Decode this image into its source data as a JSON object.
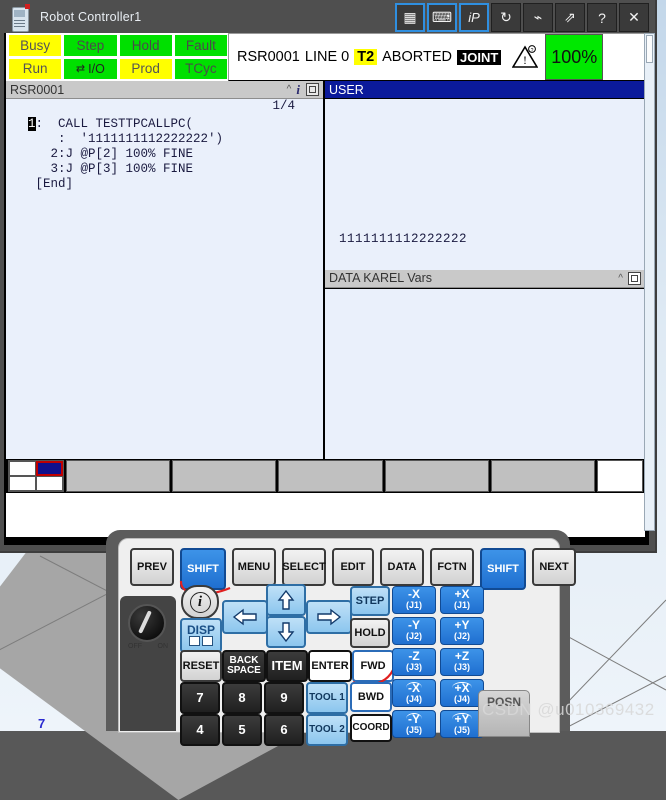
{
  "window": {
    "title": "Robot Controller1",
    "icon": "teach-pendant-icon",
    "toolbar": [
      {
        "name": "teach-pendant-view-button",
        "glyph": "▦",
        "selected": true
      },
      {
        "name": "keyboard-button",
        "glyph": "⌨",
        "selected": true
      },
      {
        "name": "ip-button",
        "glyph": "iP",
        "selected": true
      },
      {
        "name": "refresh-button",
        "glyph": "↻",
        "selected": false
      },
      {
        "name": "robot-button",
        "glyph": "⌁",
        "selected": false
      },
      {
        "name": "detach-button",
        "glyph": "⇗",
        "selected": false
      },
      {
        "name": "help-button",
        "glyph": "?",
        "selected": false
      },
      {
        "name": "close-button",
        "glyph": "✕",
        "selected": false
      }
    ]
  },
  "status_leds": [
    {
      "label": "Busy",
      "state": "yellow"
    },
    {
      "label": "Step",
      "state": "green"
    },
    {
      "label": "Hold",
      "state": "green"
    },
    {
      "label": "Fault",
      "state": "green"
    },
    {
      "label": "Run",
      "state": "yellow"
    },
    {
      "label": "I/O",
      "state": "green"
    },
    {
      "label": "Prod",
      "state": "yellow"
    },
    {
      "label": "TCyc",
      "state": "green"
    }
  ],
  "status_line": {
    "program": "RSR0001",
    "line_label": "LINE 0",
    "mode": "T2",
    "run_state": "ABORTED",
    "coord": "JOINT",
    "override": "100%",
    "warn_icon": "warning-triangle-icon",
    "override_color": "#00e800",
    "mode_color": "#ffff00"
  },
  "left_pane": {
    "header": "RSR0001",
    "page_indicator": "1/4",
    "code": [
      {
        "num": "1",
        "cursor": true,
        "text": ":  CALL TESTTPCALLPC("
      },
      {
        "num": "",
        "cursor": false,
        "text": "    :  '1111111112222222')"
      },
      {
        "num": "",
        "cursor": false,
        "text": "   2:J @P[2] 100% FINE"
      },
      {
        "num": "",
        "cursor": false,
        "text": "   3:J @P[3] 100% FINE"
      },
      {
        "num": "",
        "cursor": false,
        "text": " [End]"
      }
    ]
  },
  "right_pane": {
    "user_header": "USER",
    "user_text": "1111111112222222",
    "karel_header": "DATA KAREL Vars"
  },
  "function_keys": [
    "",
    "",
    "",
    "",
    ""
  ],
  "keypad": {
    "row1": [
      {
        "label": "PREV",
        "style": "plain"
      },
      {
        "label": "SHIFT",
        "style": "blue"
      },
      {
        "label": "MENU",
        "style": "plain"
      },
      {
        "label": "SELECT",
        "style": "plain"
      },
      {
        "label": "EDIT",
        "style": "plain"
      },
      {
        "label": "DATA",
        "style": "plain"
      },
      {
        "label": "FCTN",
        "style": "plain"
      },
      {
        "label": "SHIFT",
        "style": "blue"
      },
      {
        "label": "NEXT",
        "style": "plain"
      }
    ],
    "info_key": "i",
    "disp_key": "DISP",
    "arrow_keys": [
      "left-arrow",
      "up-arrow",
      "right-arrow",
      "down-arrow"
    ],
    "step_key": "STEP",
    "hold_key": "HOLD",
    "reset_key": "RESET",
    "backspace_key": "BACK SPACE",
    "item_key": "ITEM",
    "enter_key": "ENTER",
    "fwd_key": "FWD",
    "bwd_key": "BWD",
    "coord_key": "COORD",
    "tool1_key": "TOOL 1",
    "tool2_key": "TOOL 2",
    "numbers": [
      "7",
      "8",
      "9",
      "4",
      "5",
      "6"
    ],
    "posn_key": "POSN",
    "estop": {
      "off": "OFF",
      "on": "ON"
    },
    "jog": [
      {
        "neg": "-X",
        "pos": "+X",
        "joint": "(J1)",
        "arc": false
      },
      {
        "neg": "-Y",
        "pos": "+Y",
        "joint": "(J2)",
        "arc": false
      },
      {
        "neg": "-Z",
        "pos": "+Z",
        "joint": "(J3)",
        "arc": false
      },
      {
        "neg": "-X",
        "pos": "+X",
        "joint": "(J4)",
        "arc": true
      },
      {
        "neg": "-Y",
        "pos": "+Y",
        "joint": "(J5)",
        "arc": true
      }
    ]
  },
  "watermark": "CSDN @u010369432",
  "blue_mark": "7"
}
